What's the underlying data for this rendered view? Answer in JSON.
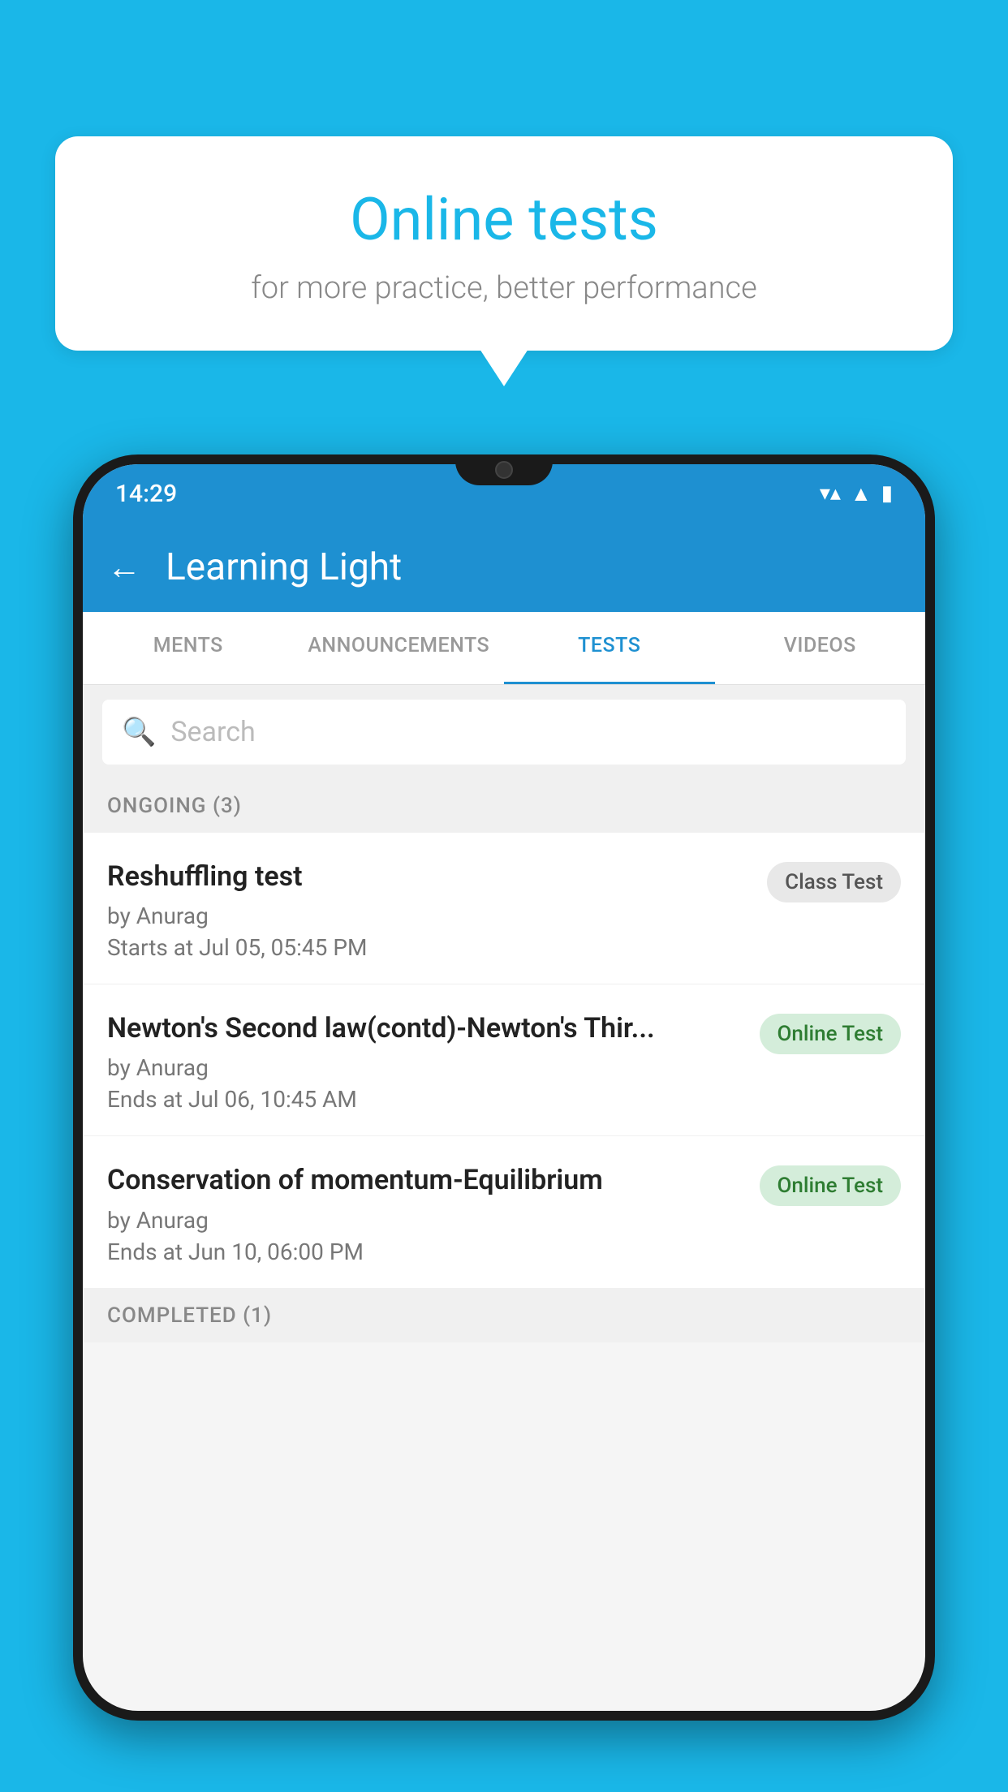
{
  "background_color": "#1ab7e8",
  "bubble": {
    "title": "Online tests",
    "subtitle": "for more practice, better performance"
  },
  "phone": {
    "status_bar": {
      "time": "14:29",
      "wifi": "▼",
      "signal": "▲",
      "battery": "▮"
    },
    "app_bar": {
      "title": "Learning Light",
      "back_label": "←"
    },
    "tabs": [
      {
        "label": "MENTS",
        "active": false
      },
      {
        "label": "ANNOUNCEMENTS",
        "active": false
      },
      {
        "label": "TESTS",
        "active": true
      },
      {
        "label": "VIDEOS",
        "active": false
      }
    ],
    "search": {
      "placeholder": "Search"
    },
    "ongoing_section": {
      "label": "ONGOING (3)"
    },
    "tests": [
      {
        "title": "Reshuffling test",
        "author": "by Anurag",
        "time_label": "Starts at",
        "time": "Jul 05, 05:45 PM",
        "badge": "Class Test",
        "badge_type": "class"
      },
      {
        "title": "Newton's Second law(contd)-Newton's Thir...",
        "author": "by Anurag",
        "time_label": "Ends at",
        "time": "Jul 06, 10:45 AM",
        "badge": "Online Test",
        "badge_type": "online"
      },
      {
        "title": "Conservation of momentum-Equilibrium",
        "author": "by Anurag",
        "time_label": "Ends at",
        "time": "Jun 10, 06:00 PM",
        "badge": "Online Test",
        "badge_type": "online"
      }
    ],
    "completed_section": {
      "label": "COMPLETED (1)"
    }
  }
}
